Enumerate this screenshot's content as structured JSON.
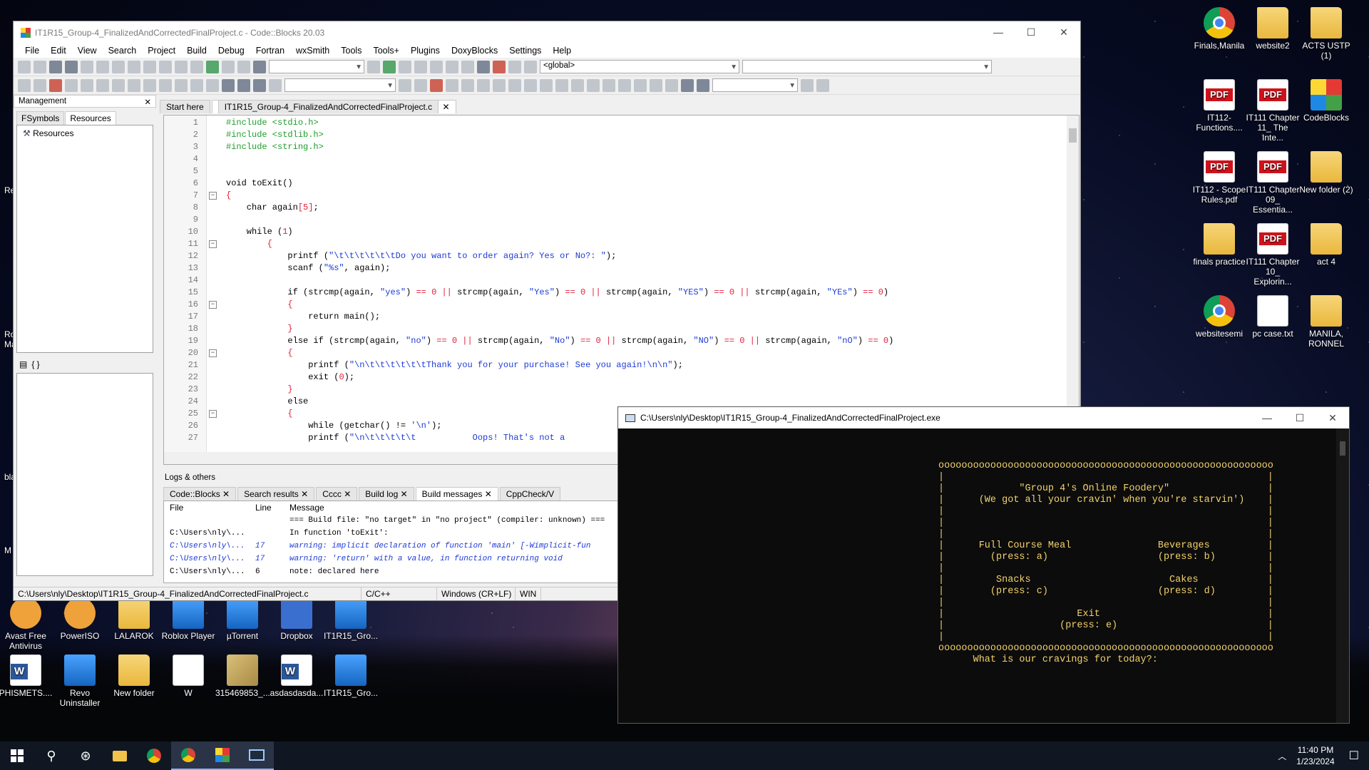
{
  "desktop": {
    "right_icons": [
      {
        "label": "Finals,Manila",
        "kind": "chrome"
      },
      {
        "label": "website2",
        "kind": "folder"
      },
      {
        "label": "ACTS USTP (1)",
        "kind": "folder"
      },
      {
        "label": "IT112-Functions....",
        "kind": "pdf"
      },
      {
        "label": "IT111 Chapter 11_ The Inte...",
        "kind": "pdf"
      },
      {
        "label": "CodeBlocks",
        "kind": "cb"
      },
      {
        "label": "IT112 - Scope Rules.pdf",
        "kind": "pdf"
      },
      {
        "label": "IT111 Chapter 09_ Essentia...",
        "kind": "pdf"
      },
      {
        "label": "New folder (2)",
        "kind": "folder"
      },
      {
        "label": "finals practice",
        "kind": "folder"
      },
      {
        "label": "IT111 Chapter 10_ Explorin...",
        "kind": "pdf"
      },
      {
        "label": "act 4",
        "kind": "folder"
      },
      {
        "label": "websitesemi",
        "kind": "chrome"
      },
      {
        "label": "pc case.txt",
        "kind": "txt"
      },
      {
        "label": "MANILA, RONNEL",
        "kind": "folder"
      }
    ],
    "bottom_icons_row1": [
      {
        "label": "Avast Free Antivirus",
        "kind": "orange"
      },
      {
        "label": "PowerISO",
        "kind": "orange"
      },
      {
        "label": "LALAROK",
        "kind": "folder"
      },
      {
        "label": "Roblox Player",
        "kind": "app"
      },
      {
        "label": "µTorrent",
        "kind": "app"
      },
      {
        "label": "Dropbox",
        "kind": "blue"
      },
      {
        "label": "IT1R15_Gro...",
        "kind": "app"
      }
    ],
    "bottom_icons_row2": [
      {
        "label": "PHISMETS....",
        "kind": "word"
      },
      {
        "label": "Revo Uninstaller",
        "kind": "app"
      },
      {
        "label": "New folder",
        "kind": "folder"
      },
      {
        "label": "W",
        "kind": "txt"
      },
      {
        "label": "315469853_...",
        "kind": "img"
      },
      {
        "label": "asdasdasda...",
        "kind": "word"
      },
      {
        "label": "IT1R15_Gro...",
        "kind": "app"
      }
    ],
    "left_fragments": [
      "Re",
      "Ro Ma",
      "bla",
      "M"
    ]
  },
  "codeblocks": {
    "title": "IT1R15_Group-4_FinalizedAndCorrectedFinalProject.c - Code::Blocks 20.03",
    "menu": [
      "File",
      "Edit",
      "View",
      "Search",
      "Project",
      "Build",
      "Debug",
      "Fortran",
      "wxSmith",
      "Tools",
      "Tools+",
      "Plugins",
      "DoxyBlocks",
      "Settings",
      "Help"
    ],
    "scope_select": "<global>",
    "management": {
      "title": "Management",
      "tabs": [
        "FSymbols",
        "Resources"
      ],
      "tree_root": "Resources",
      "symbols_toggle": "{ }"
    },
    "editor_tabs": [
      "Start here",
      "IT1R15_Group-4_FinalizedAndCorrectedFinalProject.c"
    ],
    "code_lines": [
      {
        "n": "1",
        "t": "#include <stdio.h>",
        "c": "pre",
        "fold": ""
      },
      {
        "n": "2",
        "t": "#include <stdlib.h>",
        "c": "pre",
        "fold": ""
      },
      {
        "n": "3",
        "t": "#include <string.h>",
        "c": "pre",
        "fold": ""
      },
      {
        "n": "4",
        "t": "",
        "c": "",
        "fold": ""
      },
      {
        "n": "5",
        "t": "",
        "c": "",
        "fold": ""
      },
      {
        "n": "6",
        "t": "void toExit()",
        "c": "",
        "fold": ""
      },
      {
        "n": "7",
        "t": "{",
        "c": "num",
        "fold": "−"
      },
      {
        "n": "8",
        "t": "    char again[5];",
        "c": "",
        "fold": ""
      },
      {
        "n": "9",
        "t": "",
        "c": "",
        "fold": ""
      },
      {
        "n": "10",
        "t": "    while (1)",
        "c": "",
        "fold": ""
      },
      {
        "n": "11",
        "t": "        {",
        "c": "num",
        "fold": "−"
      },
      {
        "n": "12",
        "t": "            printf (\"\\t\\t\\t\\t\\t\\tDo you want to order again? Yes or No?: \");",
        "c": "str",
        "fold": ""
      },
      {
        "n": "13",
        "t": "            scanf (\"%s\", again);",
        "c": "",
        "fold": ""
      },
      {
        "n": "14",
        "t": "",
        "c": "",
        "fold": ""
      },
      {
        "n": "15",
        "t": "            if (strcmp(again, \"yes\") == 0 || strcmp(again, \"Yes\") == 0 || strcmp(again, \"YES\") == 0 || strcmp(again, \"YEs\") == 0)",
        "c": "",
        "fold": ""
      },
      {
        "n": "16",
        "t": "            {",
        "c": "num",
        "fold": "−"
      },
      {
        "n": "17",
        "t": "                return main();",
        "c": "",
        "fold": ""
      },
      {
        "n": "18",
        "t": "            }",
        "c": "num",
        "fold": ""
      },
      {
        "n": "19",
        "t": "            else if (strcmp(again, \"no\") == 0 || strcmp(again, \"No\") == 0 || strcmp(again, \"NO\") == 0 || strcmp(again, \"nO\") == 0)",
        "c": "",
        "fold": ""
      },
      {
        "n": "20",
        "t": "            {",
        "c": "num",
        "fold": "−"
      },
      {
        "n": "21",
        "t": "                printf (\"\\n\\t\\t\\t\\t\\t\\tThank you for your purchase! See you again!\\n\\n\");",
        "c": "str",
        "fold": ""
      },
      {
        "n": "22",
        "t": "                exit (0);",
        "c": "",
        "fold": ""
      },
      {
        "n": "23",
        "t": "            }",
        "c": "num",
        "fold": ""
      },
      {
        "n": "24",
        "t": "            else",
        "c": "",
        "fold": ""
      },
      {
        "n": "25",
        "t": "            {",
        "c": "num",
        "fold": "−"
      },
      {
        "n": "26",
        "t": "                while (getchar() != '\\n');",
        "c": "",
        "fold": ""
      },
      {
        "n": "27",
        "t": "                printf (\"\\n\\t\\t\\t\\t\\t           Oops! That's not a",
        "c": "str",
        "fold": ""
      }
    ],
    "logs": {
      "title": "Logs & others",
      "tabs": [
        "Code::Blocks",
        "Search results",
        "Cccc",
        "Build log",
        "Build messages",
        "CppCheck/V"
      ],
      "headers": [
        "File",
        "Line",
        "Message"
      ],
      "rows": [
        {
          "file": "",
          "line": "",
          "msg": "=== Build file: \"no target\" in \"no project\" (compiler: unknown) ===",
          "warn": false
        },
        {
          "file": "C:\\Users\\nly\\...",
          "line": "",
          "msg": "In function 'toExit':",
          "warn": false
        },
        {
          "file": "C:\\Users\\nly\\...",
          "line": "17",
          "msg": "warning: implicit declaration of function 'main' [-Wimplicit-fun",
          "warn": true
        },
        {
          "file": "C:\\Users\\nly\\...",
          "line": "17",
          "msg": "warning: 'return' with a value, in function returning void",
          "warn": true
        },
        {
          "file": "C:\\Users\\nly\\...",
          "line": "6",
          "msg": "note: declared here",
          "warn": false
        }
      ]
    },
    "statusbar": {
      "path": "C:\\Users\\nly\\Desktop\\IT1R15_Group-4_FinalizedAndCorrectedFinalProject.c",
      "lang": "C/C++",
      "eol": "Windows (CR+LF)",
      "enc": "WIN"
    }
  },
  "console": {
    "title": "C:\\Users\\nly\\Desktop\\IT1R15_Group-4_FinalizedAndCorrectedFinalProject.exe",
    "lines": [
      "oooooooooooooooooooooooooooooooooooooooooooooooooooooooooo",
      "|                                                        |",
      "|             \"Group 4's Online Foodery\"                 |",
      "|      (We got all your cravin' when you're starvin')    |",
      "|                                                        |",
      "|                                                        |",
      "|                                                        |",
      "|      Full Course Meal               Beverages          |",
      "|        (press: a)                   (press: b)         |",
      "|                                                        |",
      "|         Snacks                        Cakes            |",
      "|        (press: c)                   (press: d)         |",
      "|                                                        |",
      "|                       Exit                             |",
      "|                    (press: e)                          |",
      "|                                                        |",
      "oooooooooooooooooooooooooooooooooooooooooooooooooooooooooo",
      "      What is our cravings for today?:"
    ]
  },
  "taskbar": {
    "time": "11:40 PM",
    "date": "1/23/2024"
  },
  "colors": {
    "console_text": "#f2d16b",
    "code_string": "#1d3bd6",
    "code_preprocessor": "#1e9e2b",
    "code_number": "#e0203a"
  }
}
